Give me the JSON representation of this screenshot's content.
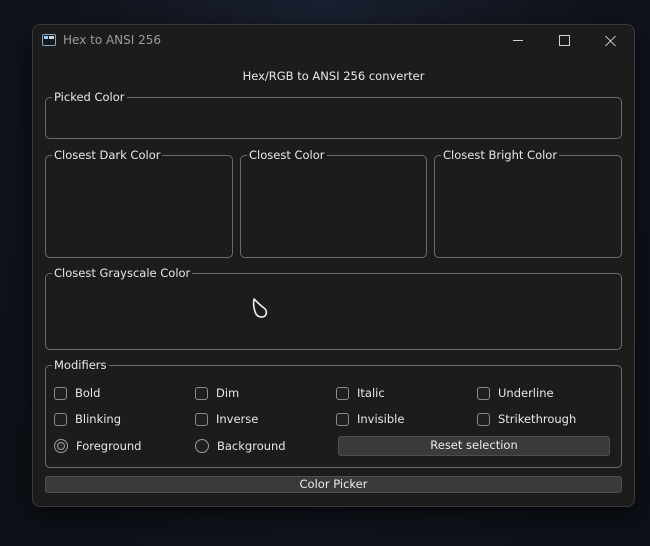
{
  "window": {
    "title": "Hex to ANSI 256",
    "controls": {
      "minimize": "minimize-icon",
      "maximize": "maximize-icon",
      "close": "close-icon"
    }
  },
  "main": {
    "heading": "Hex/RGB to ANSI 256 converter",
    "groups": {
      "picked": "Picked Color",
      "dark": "Closest Dark Color",
      "closest": "Closest Color",
      "bright": "Closest Bright Color",
      "grayscale": "Closest Grayscale Color",
      "modifiers": "Modifiers"
    }
  },
  "modifiers": {
    "checkboxes": [
      {
        "label": "Bold",
        "checked": false
      },
      {
        "label": "Dim",
        "checked": false
      },
      {
        "label": "Italic",
        "checked": false
      },
      {
        "label": "Underline",
        "checked": false
      },
      {
        "label": "Blinking",
        "checked": false
      },
      {
        "label": "Inverse",
        "checked": false
      },
      {
        "label": "Invisible",
        "checked": false
      },
      {
        "label": "Strikethrough",
        "checked": false
      }
    ],
    "radios": [
      {
        "label": "Foreground",
        "selected": true
      },
      {
        "label": "Background",
        "selected": false
      }
    ],
    "reset_label": "Reset selection"
  },
  "footer": {
    "picker_label": "Color Picker"
  },
  "colors": {
    "window_bg": "#1c1c1c",
    "border": "#6b6b6b",
    "button_bg": "#3a3a3a",
    "desktop_bg": "#10141c"
  }
}
